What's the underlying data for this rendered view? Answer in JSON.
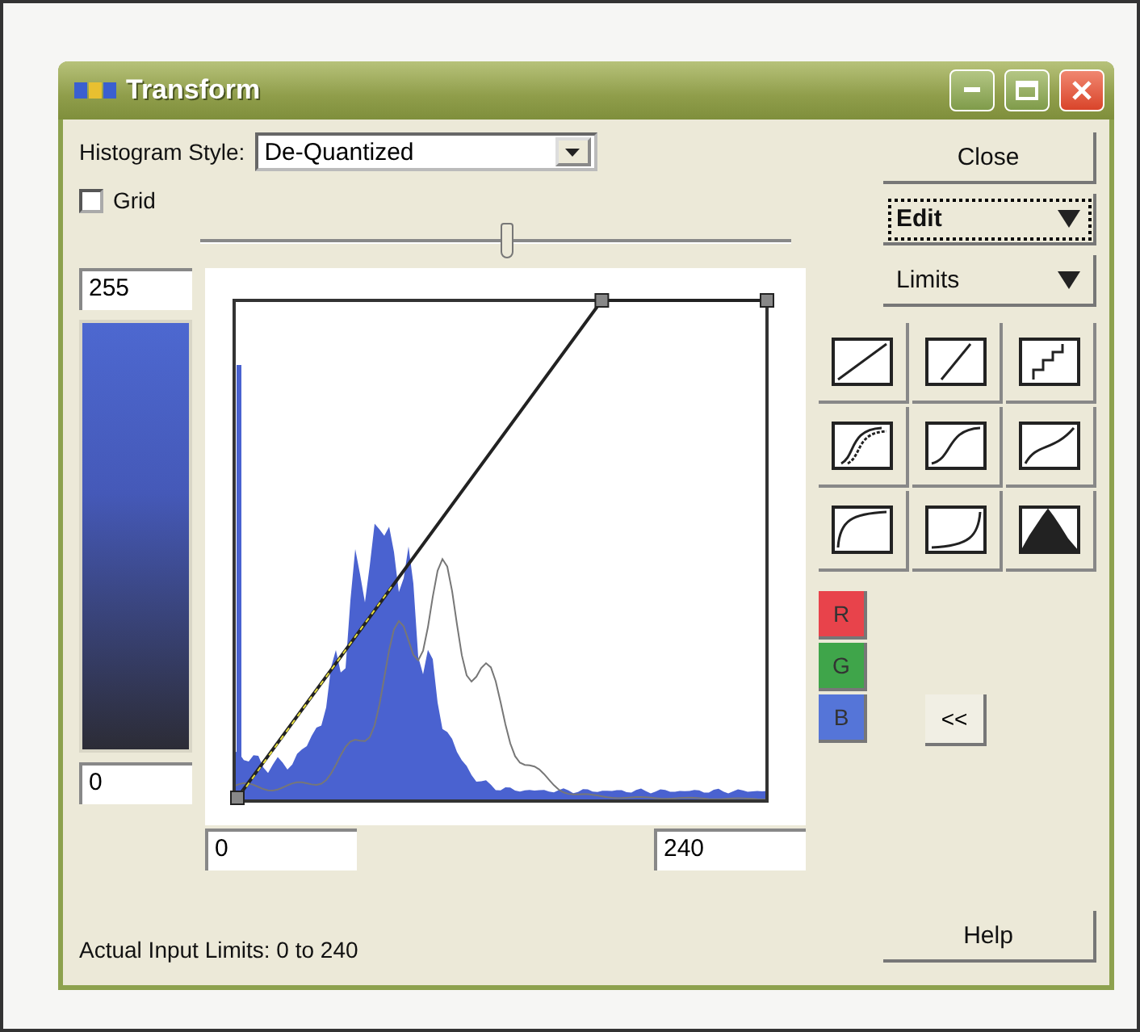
{
  "window": {
    "title": "Transform"
  },
  "histogram_style": {
    "label": "Histogram Style:",
    "value": "De-Quantized"
  },
  "grid": {
    "label": "Grid",
    "checked": false
  },
  "slider": {
    "level": 0.52
  },
  "side_buttons": [
    {
      "label": "Close",
      "kind": "push",
      "focused": false
    },
    {
      "label": "Edit",
      "kind": "menu",
      "focused": true
    },
    {
      "label": "Limits",
      "kind": "menu",
      "focused": false
    }
  ],
  "output_max": "255",
  "output_min": "0",
  "input_min": "0",
  "input_max": "240",
  "status": "Actual Input Limits: 0 to 240",
  "curve_presets": [
    {
      "kind": "linear"
    },
    {
      "kind": "steep"
    },
    {
      "kind": "steps"
    },
    {
      "kind": "double-s"
    },
    {
      "kind": "s-curve"
    },
    {
      "kind": "soft"
    },
    {
      "kind": "ease-out"
    },
    {
      "kind": "ease-in"
    },
    {
      "kind": "histogram"
    }
  ],
  "channels": [
    {
      "label": "R",
      "color": "#e8434b"
    },
    {
      "label": "G",
      "color": "#3fa54a"
    },
    {
      "label": "B",
      "color": "#5575d8"
    }
  ],
  "collapse_button": "<<",
  "help_button": "Help"
}
